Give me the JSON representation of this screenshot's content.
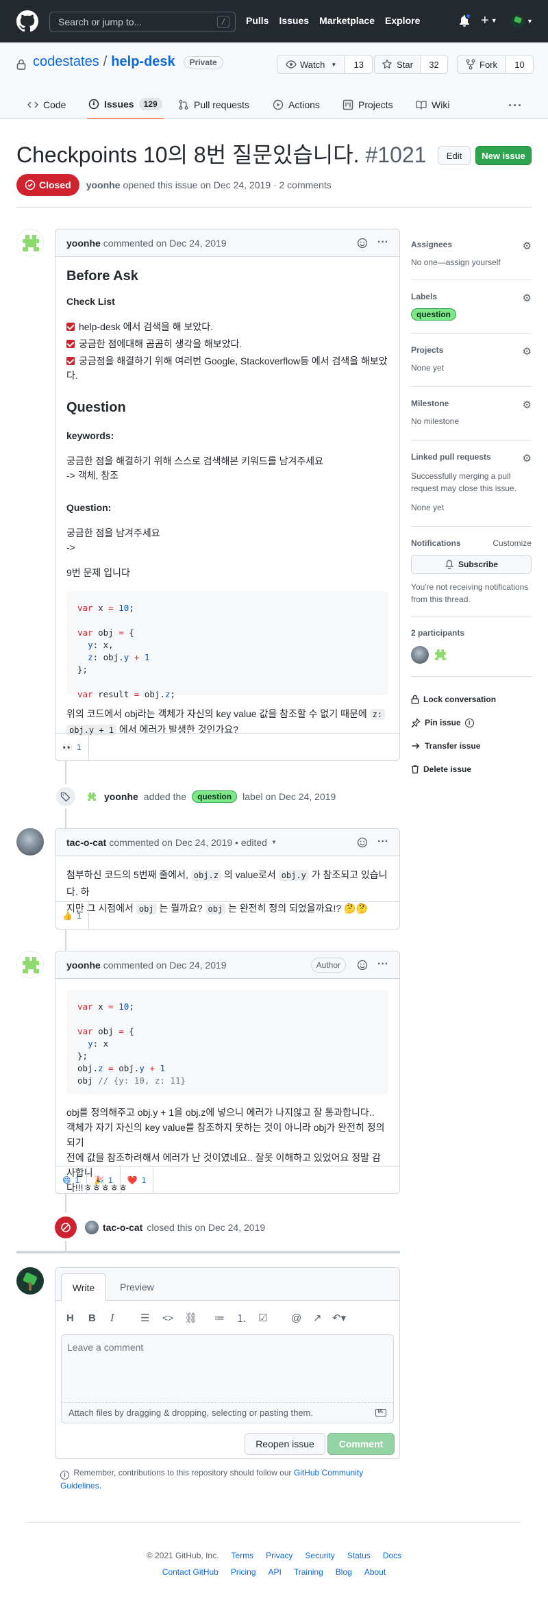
{
  "header": {
    "search_placeholder": "Search or jump to...",
    "search_shortcut": "/",
    "nav": [
      "Pulls",
      "Issues",
      "Marketplace",
      "Explore"
    ]
  },
  "repo": {
    "owner": "codestates",
    "name": "help-desk",
    "visibility": "Private",
    "watch_label": "Watch",
    "watch_count": "13",
    "star_label": "Star",
    "star_count": "32",
    "fork_label": "Fork",
    "fork_count": "10"
  },
  "tabs": [
    {
      "label": "Code"
    },
    {
      "label": "Issues",
      "count": "129"
    },
    {
      "label": "Pull requests"
    },
    {
      "label": "Actions"
    },
    {
      "label": "Projects"
    },
    {
      "label": "Wiki"
    }
  ],
  "issue": {
    "title": "Checkpoints 10의 8번 질문있습니다.",
    "number": "#1021",
    "edit_label": "Edit",
    "new_issue_label": "New issue",
    "state": "Closed",
    "author": "yoonhe",
    "meta": "opened this issue on Dec 24, 2019 · 2 comments"
  },
  "comment1": {
    "author": "yoonhe",
    "meta": "commented on Dec 24, 2019",
    "h_before": "Before Ask",
    "h_checklist": "Check List",
    "checks": [
      "help-desk 에서 검색을 해 보았다.",
      "궁금한 점에대해 곰곰히 생각을 해보았다.",
      "궁금점을 해결하기 위해 여러번 Google, Stackoverflow등 에서 검색을 해보았다."
    ],
    "h_question": "Question",
    "keywords_label": "keywords:",
    "keywords_line1": "궁금한 점을 해결하기 위해 스스로 검색해본 키워드를 남겨주세요",
    "keywords_line2": "-> 객체, 참조",
    "question_label": "Question:",
    "question_line1": "궁금한 점을 남겨주세요",
    "question_line2": "->",
    "problem": "9번 문제 입니다",
    "para_a": "위의 코드에서 obj라는 객체가 자신의 key value 값을 참조할 수 없기 때문에",
    "code_a": "z:",
    "code_b": "obj.y + 1",
    "para_b": "에서 에러가 발생한 것인가요?",
    "reaction_emoji": "👀",
    "reaction_count": "1"
  },
  "label_event": {
    "author": "yoonhe",
    "text_before": "added the",
    "label": "question",
    "text_after": "label on Dec 24, 2019"
  },
  "comment2": {
    "author": "tac-o-cat",
    "meta": "commented on Dec 24, 2019 • edited",
    "p1": "첨부하신 코드의 5번째 줄에서,",
    "c1": "obj.z",
    "p2": "의 value로서",
    "c2": "obj.y",
    "p3": "가 참조되고 있습니다. 하",
    "p4": "지만 그 시점에서",
    "c3": "obj",
    "p5": "는 뭘까요?",
    "c4": "obj",
    "p6": "는 완전히 정의 되었을까요!? 🤔🤔",
    "reaction_emoji": "👍",
    "reaction_count": "1"
  },
  "comment3": {
    "author": "yoonhe",
    "meta": "commented on Dec 24, 2019",
    "author_badge": "Author",
    "text_l1": "obj를 정의해주고 obj.y + 1을 obj.z에 넣으니 에러가 나지않고 잘 통과합니다..",
    "text_l2": "객체가 자기 자신의 key value를 참조하지 못하는 것이 아니라 obj가 완전히 정의되기",
    "text_l3": "전에 값을 참조하려해서 에러가 난 것이였네요.. 잘못 이해하고 있었어요 정말 감사합니",
    "text_l4": "다!!!ㅎㅎㅎㅎㅎ",
    "reactions": [
      {
        "emoji": "😄",
        "count": "1"
      },
      {
        "emoji": "🎉",
        "count": "1"
      },
      {
        "emoji": "❤️",
        "count": "1"
      }
    ]
  },
  "closed_event": {
    "author": "tac-o-cat",
    "text": "closed this on Dec 24, 2019"
  },
  "composer": {
    "tab_write": "Write",
    "tab_preview": "Preview",
    "placeholder": "Leave a comment",
    "attach_hint": "Attach files by dragging & dropping, selecting or pasting them.",
    "reopen_label": "Reopen issue",
    "comment_label": "Comment",
    "guideline_text": "Remember, contributions to this repository should follow our",
    "guideline_link": "GitHub Community Guidelines."
  },
  "sidebar": {
    "assignees_title": "Assignees",
    "assignees_value": "No one—assign yourself",
    "labels_title": "Labels",
    "labels_value": "question",
    "projects_title": "Projects",
    "projects_value": "None yet",
    "milestone_title": "Milestone",
    "milestone_value": "No milestone",
    "linked_title": "Linked pull requests",
    "linked_desc_1": "Successfully merging a pull",
    "linked_desc_2": "request may close this issue.",
    "linked_value": "None yet",
    "notifications_title": "Notifications",
    "customize": "Customize",
    "subscribe": "Subscribe",
    "notify_1": "You're not receiving notifications",
    "notify_2": "from this thread.",
    "participants": "2 participants",
    "lock": "Lock conversation",
    "pin": "Pin issue",
    "transfer": "Transfer issue",
    "delete": "Delete issue"
  },
  "footer": {
    "copyright": "© 2021 GitHub, Inc.",
    "row1": [
      "Terms",
      "Privacy",
      "Security",
      "Status",
      "Docs"
    ],
    "row2": [
      "Contact GitHub",
      "Pricing",
      "API",
      "Training",
      "Blog",
      "About"
    ]
  },
  "colors": {
    "header_bg": "#24292f",
    "closed_red": "#cf222e",
    "new_issue_green": "#2da44e",
    "label_green": "#7ee787",
    "link_blue": "#0969da"
  }
}
